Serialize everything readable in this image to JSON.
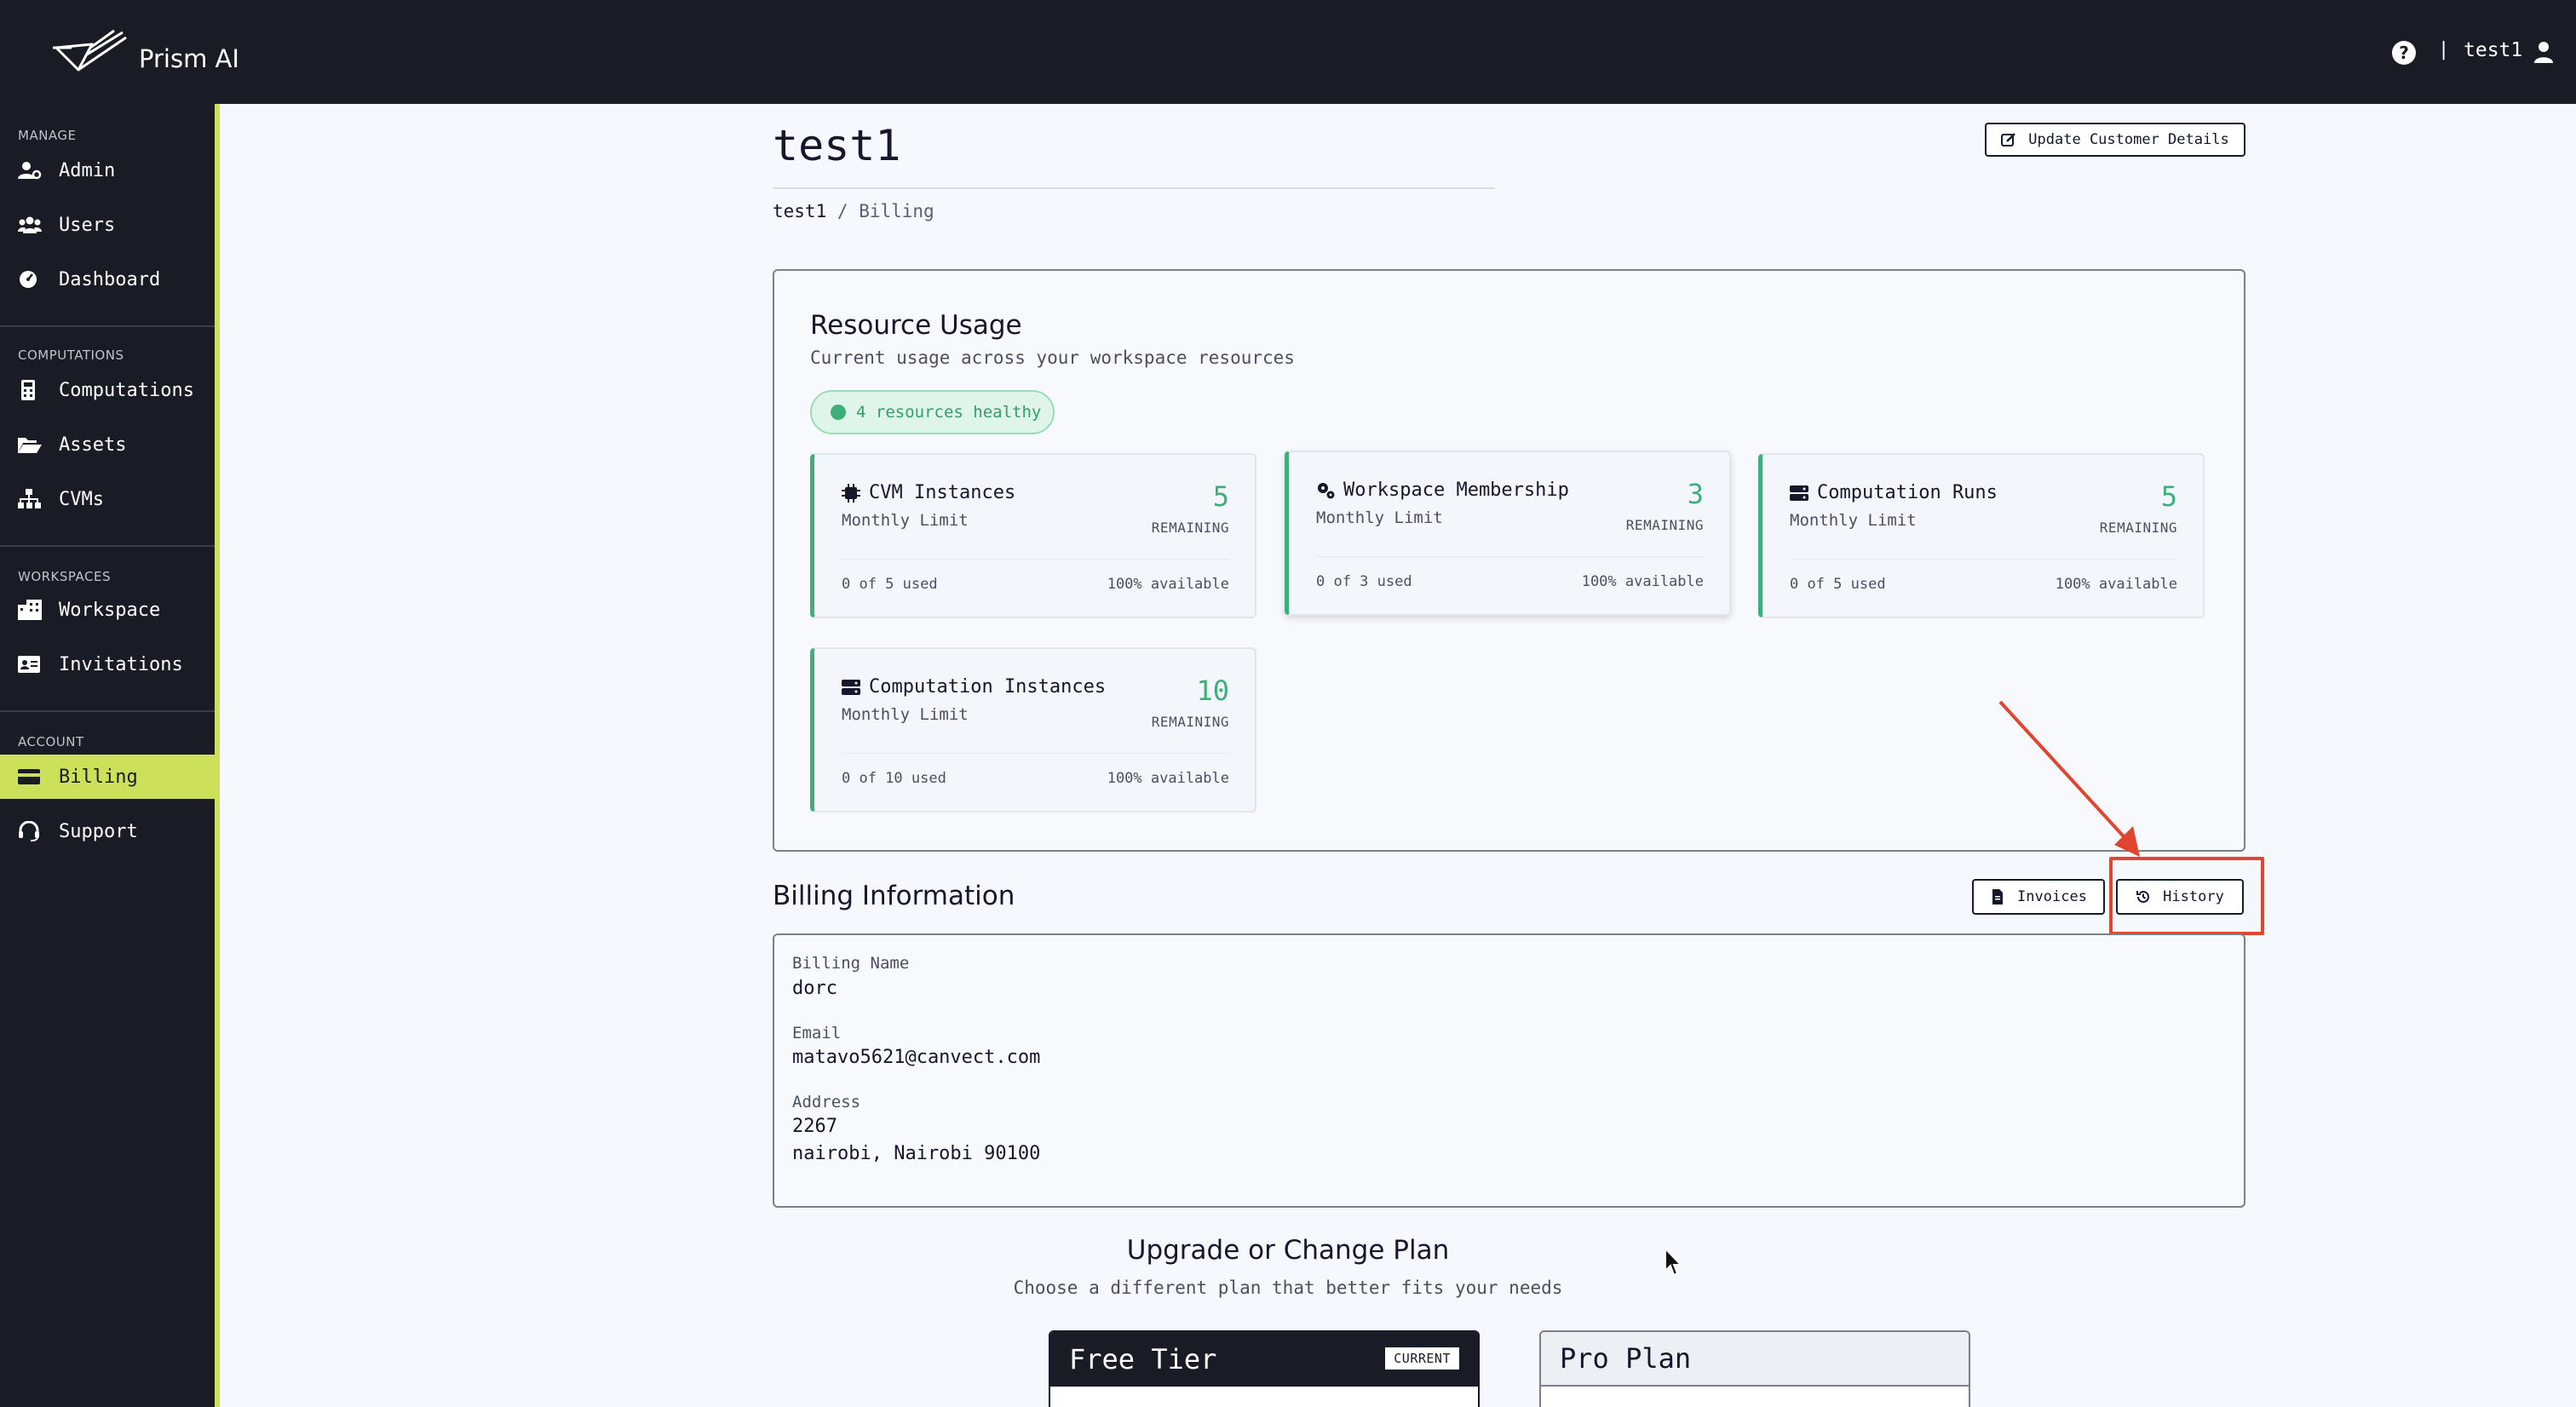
{
  "app": {
    "name": "Prism AI",
    "user": "test1",
    "separator": "|"
  },
  "icons": {
    "help": "help-circle-icon",
    "user": "user-icon",
    "logo": "prism-logo-icon",
    "admin": "user-cog-icon",
    "users": "users-icon",
    "dashboard": "gauge-icon",
    "computations": "calculator-icon",
    "assets": "folder-open-icon",
    "cvms": "sitemap-icon",
    "workspace": "building-icon",
    "invitations": "id-card-icon",
    "billing": "credit-card-icon",
    "support": "headset-icon"
  },
  "colors": {
    "accent": "#cde05a",
    "dark": "#1a1c25",
    "success": "#3fae7a",
    "annotation": "#e2452f"
  },
  "sidebar": {
    "sections": [
      {
        "title": "MANAGE",
        "items": [
          "Admin",
          "Users",
          "Dashboard"
        ]
      },
      {
        "title": "COMPUTATIONS",
        "items": [
          "Computations",
          "Assets",
          "CVMs"
        ]
      },
      {
        "title": "WORKSPACES",
        "items": [
          "Workspace",
          "Invitations"
        ]
      },
      {
        "title": "ACCOUNT",
        "items": [
          "Billing",
          "Support"
        ]
      }
    ],
    "active": "Billing"
  },
  "header": {
    "title": "test1",
    "breadcrumb": {
      "root": "test1",
      "sep": "/",
      "current": "Billing"
    },
    "update_button": "Update Customer Details"
  },
  "resources": {
    "title": "Resource Usage",
    "subtitle": "Current usage across your workspace resources",
    "healthy_badge": "4 resources healthy",
    "cards": [
      {
        "title": "CVM Instances",
        "sub": "Monthly Limit",
        "remaining": "5",
        "remaining_label": "REMAINING",
        "used": "0 of 5 used",
        "available": "100% available",
        "icon": "chip-icon"
      },
      {
        "title": "Workspace Membership",
        "sub": "Monthly Limit",
        "remaining": "3",
        "remaining_label": "REMAINING",
        "used": "0 of 3 used",
        "available": "100% available",
        "icon": "cogs-icon"
      },
      {
        "title": "Computation Runs",
        "sub": "Monthly Limit",
        "remaining": "5",
        "remaining_label": "REMAINING",
        "used": "0 of 5 used",
        "available": "100% available",
        "icon": "server-icon"
      },
      {
        "title": "Computation Instances",
        "sub": "Monthly Limit",
        "remaining": "10",
        "remaining_label": "REMAINING",
        "used": "0 of 10 used",
        "available": "100% available",
        "icon": "server-icon"
      }
    ]
  },
  "billing": {
    "title": "Billing Information",
    "invoices_button": "Invoices",
    "history_button": "History",
    "name_label": "Billing Name",
    "name": "dorc",
    "email_label": "Email",
    "email": "matavo5621@canvect.com",
    "address_label": "Address",
    "address_line1": "2267",
    "address_line2": "nairobi, Nairobi 90100"
  },
  "plans": {
    "title": "Upgrade or Change Plan",
    "subtitle": "Choose a different plan that better fits your needs",
    "items": [
      {
        "name": "Free Tier",
        "badge": "CURRENT"
      },
      {
        "name": "Pro Plan"
      }
    ]
  }
}
